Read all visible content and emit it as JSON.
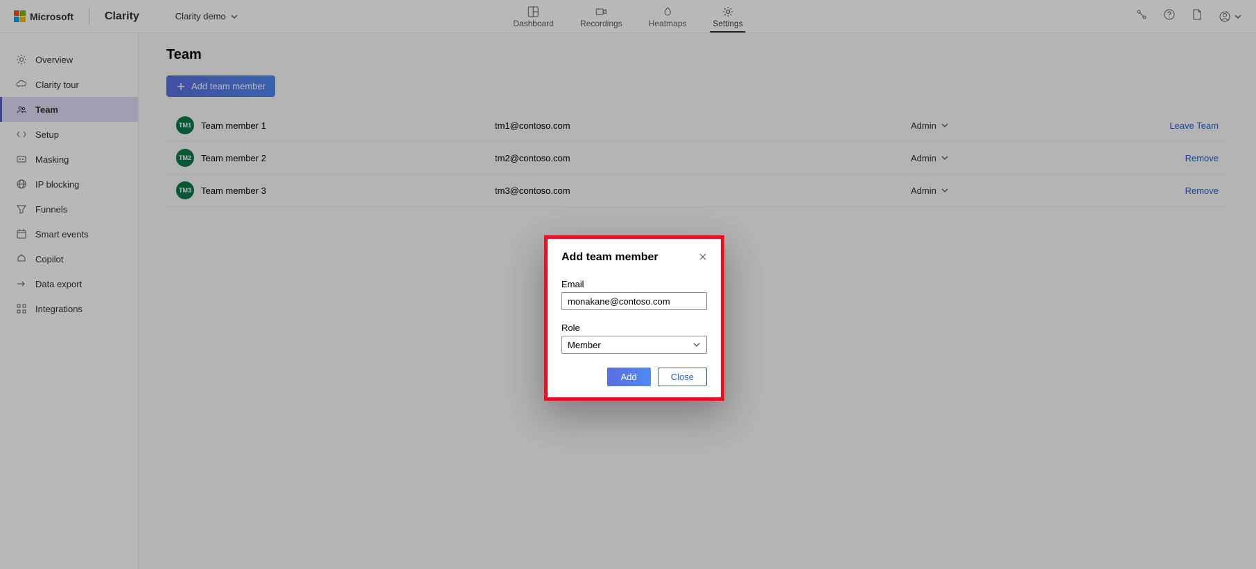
{
  "header": {
    "microsoft": "Microsoft",
    "product": "Clarity",
    "project": "Clarity demo",
    "nav": {
      "dashboard": "Dashboard",
      "recordings": "Recordings",
      "heatmaps": "Heatmaps",
      "settings": "Settings"
    }
  },
  "sidebar": {
    "overview": "Overview",
    "tour": "Clarity tour",
    "team": "Team",
    "setup": "Setup",
    "masking": "Masking",
    "ipblocking": "IP blocking",
    "funnels": "Funnels",
    "smartevents": "Smart events",
    "copilot": "Copilot",
    "dataexport": "Data export",
    "integrations": "Integrations"
  },
  "page": {
    "title": "Team",
    "add_button": "Add team member"
  },
  "team": [
    {
      "initials": "TM1",
      "name": "Team member 1",
      "email": "tm1@contoso.com",
      "role": "Admin",
      "action": "Leave Team"
    },
    {
      "initials": "TM2",
      "name": "Team member 2",
      "email": "tm2@contoso.com",
      "role": "Admin",
      "action": "Remove"
    },
    {
      "initials": "TM3",
      "name": "Team member 3",
      "email": "tm3@contoso.com",
      "role": "Admin",
      "action": "Remove"
    }
  ],
  "dialog": {
    "title": "Add team member",
    "email_label": "Email",
    "email_value": "monakane@contoso.com",
    "role_label": "Role",
    "role_value": "Member",
    "add_btn": "Add",
    "close_btn": "Close"
  }
}
